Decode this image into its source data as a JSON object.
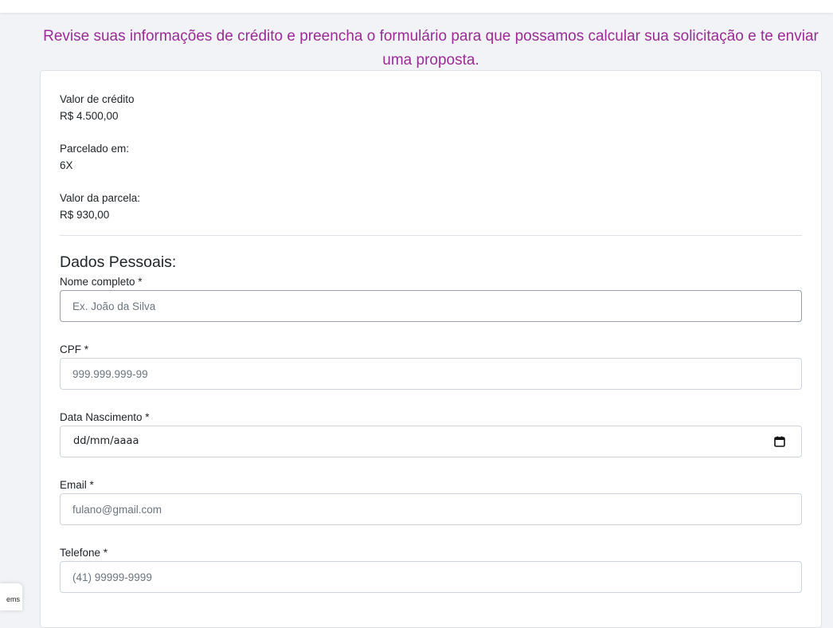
{
  "intro_text": "Revise suas informações de crédito e preencha o formulário para que possamos calcular sua solicitação e te enviar uma proposta.",
  "summary": {
    "credit_label": "Valor de crédito",
    "credit_value": "R$ 4.500,00",
    "installments_label": "Parcelado em:",
    "installments_value": "6X",
    "installment_value_label": "Valor da parcela:",
    "installment_value": "R$ 930,00"
  },
  "personal": {
    "title": "Dados Pessoais:",
    "name_label": "Nome completo *",
    "name_placeholder": "Ex. João da Silva",
    "cpf_label": "CPF *",
    "cpf_placeholder": "999.999.999-99",
    "birth_label": "Data Nascimento *",
    "birth_placeholder": "dd/mm/aaaa",
    "email_label": "Email *",
    "email_placeholder": "fulano@gmail.com",
    "phone_label": "Telefone *",
    "phone_placeholder": "(41) 99999-9999"
  },
  "widget_text": "ems",
  "colors": {
    "accent": "#9b2d96",
    "background": "#f1f3f7",
    "border": "#ced4da"
  }
}
